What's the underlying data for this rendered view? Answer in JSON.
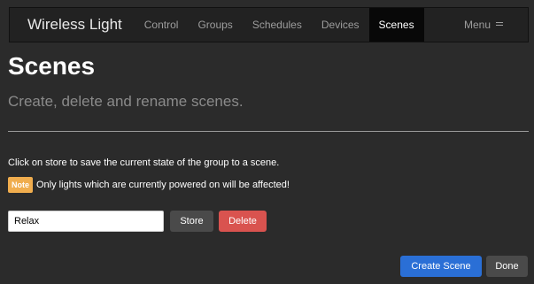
{
  "app": {
    "brand": "Wireless Light"
  },
  "nav": {
    "items": [
      {
        "label": "Control"
      },
      {
        "label": "Groups"
      },
      {
        "label": "Schedules"
      },
      {
        "label": "Devices"
      },
      {
        "label": "Scenes"
      }
    ],
    "active": "Scenes",
    "menu_label": "Menu"
  },
  "page": {
    "title": "Scenes",
    "subtitle": "Create, delete and rename scenes."
  },
  "content": {
    "instructions": "Click on store to save the current state of the group to a scene.",
    "note_badge": "Note",
    "note_text": "Only lights which are currently powered on will be affected!"
  },
  "scene_form": {
    "input_value": "Relax",
    "store_label": "Store",
    "delete_label": "Delete"
  },
  "footer": {
    "create_label": "Create Scene",
    "done_label": "Done"
  },
  "colors": {
    "background": "#2b2b2b",
    "navbar": "#222222",
    "nav_active": "#080808",
    "note_badge": "#f0ad4e",
    "delete_button": "#d9534f",
    "primary_button": "#2a6fd6",
    "default_button": "#4a4a4a"
  }
}
